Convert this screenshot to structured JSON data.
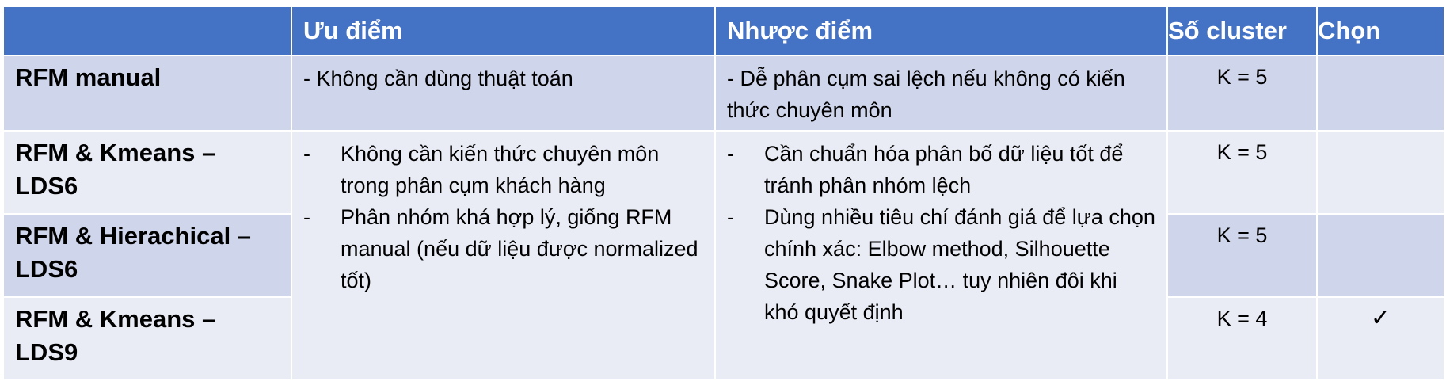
{
  "header": {
    "col_method": "",
    "col_pros": "Ưu điểm",
    "col_cons": "Nhược điểm",
    "col_clusters": "Số cluster",
    "col_choose": "Chọn"
  },
  "rows": [
    {
      "method": "RFM manual",
      "pros": "- Không cần dùng thuật toán",
      "cons": "- Dễ phân cụm sai lệch nếu không có kiến thức chuyên môn",
      "clusters": "K = 5",
      "chosen": ""
    },
    {
      "method": "RFM & Kmeans – LDS6",
      "clusters": "K = 5",
      "chosen": ""
    },
    {
      "method": "RFM & Hierachical – LDS6",
      "clusters": "K = 5",
      "chosen": ""
    },
    {
      "method": "RFM & Kmeans – LDS9",
      "clusters": "K = 4",
      "chosen": "✓"
    }
  ],
  "shared_pros": {
    "bullet": "-",
    "items": [
      "Không cần kiến thức chuyên môn trong phân cụm khách hàng",
      "Phân nhóm khá hợp lý, giống RFM manual (nếu dữ liệu được normalized tốt)"
    ]
  },
  "shared_cons": {
    "bullet": "-",
    "items": [
      "Cần chuẩn hóa phân bố dữ liệu tốt để tránh phân nhóm lệch",
      "Dùng nhiều tiêu chí đánh giá để lựa chọn chính xác: Elbow method, Silhouette Score, Snake Plot… tuy nhiên đôi khi khó quyết định"
    ]
  },
  "colors": {
    "header_bg": "#4472c4",
    "band_dark": "#cfd5ea",
    "band_light": "#e9ebf5"
  }
}
